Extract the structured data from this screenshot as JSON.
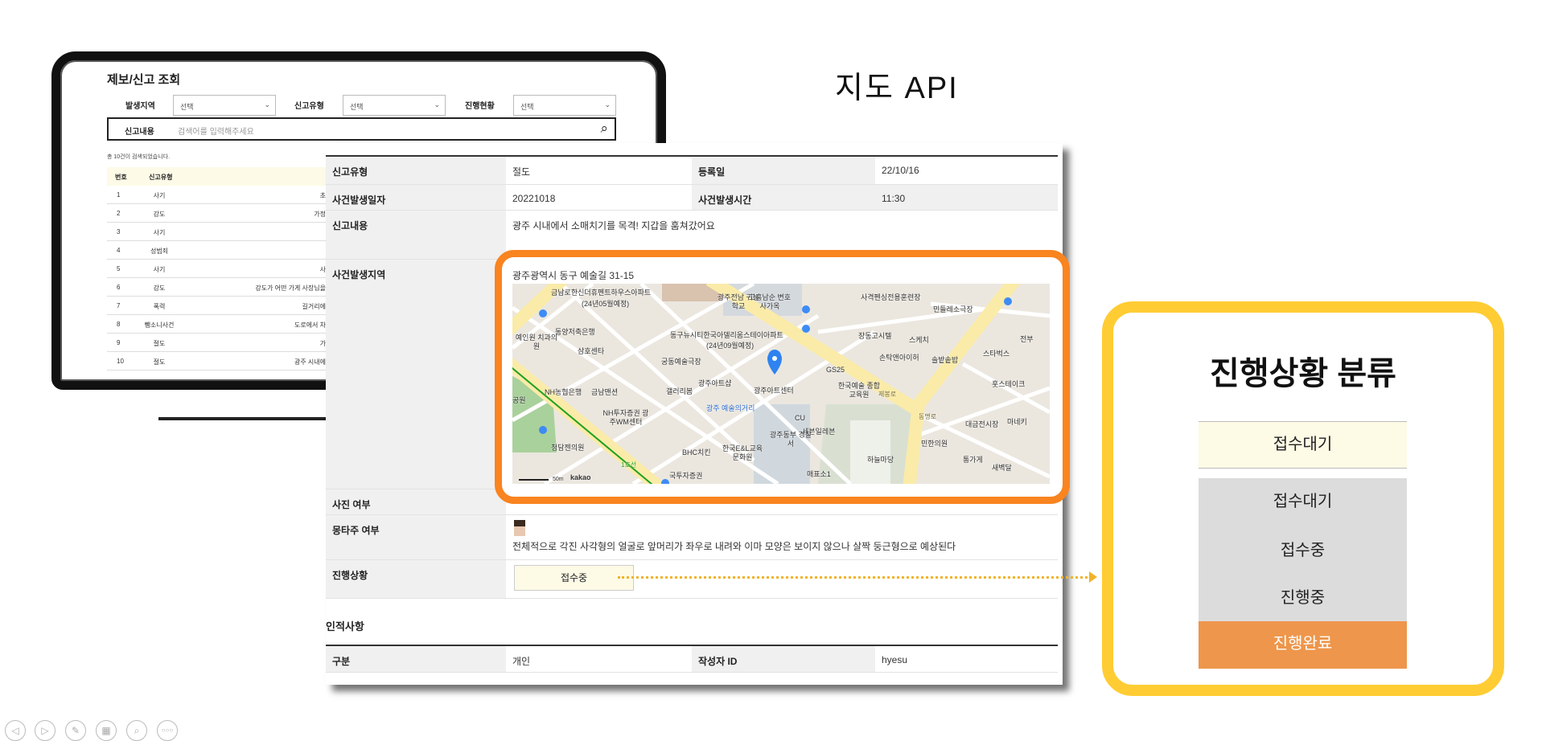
{
  "slide_title": "지도 API",
  "list_screen": {
    "title": "제보/신고 조회",
    "filters": [
      {
        "label": "발생지역",
        "value": "선택"
      },
      {
        "label": "신고유형",
        "value": "선택"
      },
      {
        "label": "진행현황",
        "value": "선택"
      }
    ],
    "search": {
      "label": "신고내용",
      "placeholder": "검색어를 입력해주세요"
    },
    "result_count": "총 10건이 검색되었습니다.",
    "columns": [
      "번호",
      "신고유형"
    ],
    "rows": [
      {
        "no": "1",
        "type": "사기",
        "content": "초"
      },
      {
        "no": "2",
        "type": "강도",
        "content": "가정"
      },
      {
        "no": "3",
        "type": "사기",
        "content": ""
      },
      {
        "no": "4",
        "type": "성범죄",
        "content": ""
      },
      {
        "no": "5",
        "type": "사기",
        "content": "사"
      },
      {
        "no": "6",
        "type": "강도",
        "content": "강도가 어떤 가게 사장님을"
      },
      {
        "no": "7",
        "type": "폭력",
        "content": "길거리에"
      },
      {
        "no": "8",
        "type": "뺑소니사건",
        "content": "도로에서 차"
      },
      {
        "no": "9",
        "type": "절도",
        "content": "가"
      },
      {
        "no": "10",
        "type": "절도",
        "content": "광주 시내에"
      }
    ]
  },
  "detail": {
    "report_type_label": "신고유형",
    "report_type": "절도",
    "reg_date_label": "등록일",
    "reg_date": "22/10/16",
    "incident_date_label": "사건발생일자",
    "incident_date": "20221018",
    "incident_time_label": "사건발생시간",
    "incident_time": "11:30",
    "content_label": "신고내용",
    "content": "광주 시내에서 소매치기를 목격! 지갑을 훔쳐갔어요",
    "location_label": "사건발생지역",
    "address": "광주광역시 동구 예술길 31-15",
    "photo_label": "사진 여부",
    "montage_label": "몽타주 여부",
    "montage_desc": "전체적으로 각진 사각형의 얼굴로 앞머리가 좌우로 내려와 이마 모양은 보이지 않으나 살짝 둥근형으로 예상된다",
    "status_label": "진행상황",
    "status": "접수중",
    "person_section": "인적사항",
    "category_label": "구분",
    "category": "개인",
    "writer_label": "작성자 ID",
    "writer": "hyesu"
  },
  "map": {
    "scale": "50m",
    "brand": "kakao",
    "labels": [
      "금남로한신더휴펜트하우스아파트",
      "(24년05월예정)",
      "광주전남 귀농학교",
      "고흥남순 변호사가옥",
      "동구뉴시티한국아델리움스테이아파트",
      "(24년09월예정)",
      "동양저축은행",
      "예인원 치과의원",
      "삼호센타",
      "궁동예술극장",
      "광주아트샵",
      "갤러리봄",
      "NH농협은행",
      "금남맨션",
      "공원",
      "광주 예술의거리",
      "NH투자증권 광주WM센터",
      "청담젠의원",
      "BHC치킨",
      "한국E&L교육 문화원",
      "국투자증권",
      "광주아트센터",
      "사격펜싱전용훈련장",
      "민들레소극장",
      "장동고시텔",
      "스케치",
      "손탁앤아이허",
      "솔밭솥밥",
      "스타벅스",
      "전부",
      "GS25",
      "한국예술 종합교육원",
      "훗스테이크",
      "CU",
      "세븐일레븐",
      "광주동부 경찰서",
      "대금전시장",
      "마네키",
      "민한의원",
      "하늘마당",
      "통가게",
      "새벽달",
      "매표소1",
      "제봉로",
      "동명로",
      "1호선"
    ]
  },
  "status_panel": {
    "title": "진행상황 분류",
    "selected": "접수대기",
    "options": [
      "접수대기",
      "접수중",
      "진행중",
      "진행완료"
    ]
  },
  "nav_icons": [
    "prev-icon",
    "next-icon",
    "pen-icon",
    "slides-icon",
    "zoom-icon",
    "more-icon"
  ],
  "colors": {
    "orange": "#F98420",
    "yellow": "#FFCC33",
    "done": "#EE964B",
    "selected_bg": "#FDFAE6"
  }
}
